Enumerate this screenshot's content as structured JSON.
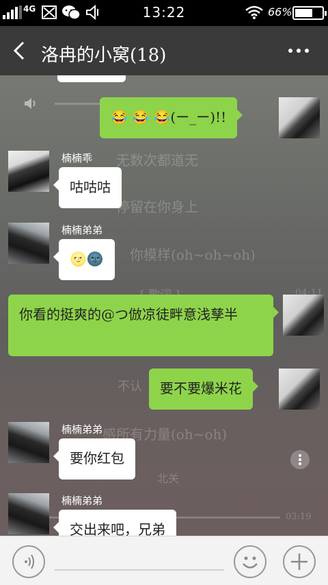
{
  "status_bar": {
    "network": "4G",
    "time": "13:22",
    "battery": "66%",
    "battery_level": 0.66
  },
  "header": {
    "back_icon": "chevron-left-icon",
    "title": "洛冉的小窝(18)",
    "more_icon": "more-icon"
  },
  "background_lyrics": [
    "无数次都道无",
    "停留在你身上",
    "你模样(oh~oh~oh)",
    "[ 歌词 ]",
    "不认",
    "感所有力量(oh~oh)",
    "北关"
  ],
  "background_player": {
    "time_mid": "04:11",
    "time_end": "03:19"
  },
  "messages": [
    {
      "side": "right",
      "sender": "",
      "text": "😂 😂 😂(ー_ー)!!",
      "avatar": "self-avatar"
    },
    {
      "side": "left",
      "sender": "楠楠乖",
      "text": "咕咕咕",
      "avatar": "girl-avatar"
    },
    {
      "side": "left",
      "sender": "楠楠弟弟",
      "text": "🌝🌚",
      "avatar": "boy-avatar"
    },
    {
      "side": "right",
      "sender": "",
      "text": "你看的挺爽的@つ倣凉徒畔意浅孳半",
      "avatar": "self-avatar"
    },
    {
      "side": "right",
      "sender": "",
      "text": "要不要爆米花",
      "avatar": "self-avatar"
    },
    {
      "side": "left",
      "sender": "楠楠弟弟",
      "text": "要你红包",
      "avatar": "boy-avatar"
    },
    {
      "side": "left",
      "sender": "楠楠弟弟",
      "text": "交出来吧，兄弟",
      "avatar": "boy-avatar"
    }
  ],
  "input_bar": {
    "voice_icon": "voice-icon",
    "emoji_icon": "emoji-icon",
    "plus_icon": "plus-icon"
  },
  "colors": {
    "sent_bubble": "#8ed44a",
    "received_bubble": "#ffffff",
    "title_bar": "#3a3a3a"
  }
}
